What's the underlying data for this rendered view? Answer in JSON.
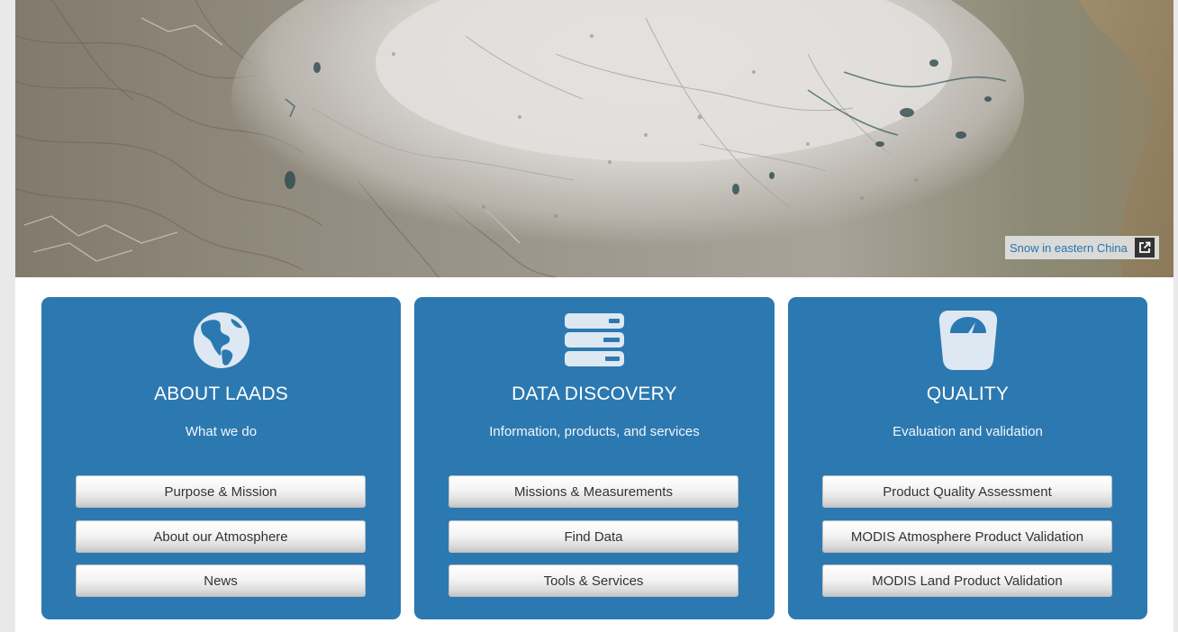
{
  "hero": {
    "caption": "Snow in eastern China",
    "caption_icon": "external-link-icon"
  },
  "panels": [
    {
      "icon": "globe-americas-icon",
      "title": "ABOUT LAADS",
      "subtitle": "What we do",
      "buttons": [
        "Purpose & Mission",
        "About our Atmosphere",
        "News"
      ]
    },
    {
      "icon": "server-stack-icon",
      "title": "DATA DISCOVERY",
      "subtitle": "Information, products, and services",
      "buttons": [
        "Missions & Measurements",
        "Find Data",
        "Tools & Services"
      ]
    },
    {
      "icon": "weight-scale-icon",
      "title": "QUALITY",
      "subtitle": "Evaluation and validation",
      "buttons": [
        "Product Quality Assessment",
        "MODIS Atmosphere Product Validation",
        "MODIS Land Product Validation"
      ]
    }
  ],
  "colors": {
    "panel_blue": "#2c79b1",
    "link_blue": "#2a73ad",
    "page_bg": "#e9e9e9"
  }
}
